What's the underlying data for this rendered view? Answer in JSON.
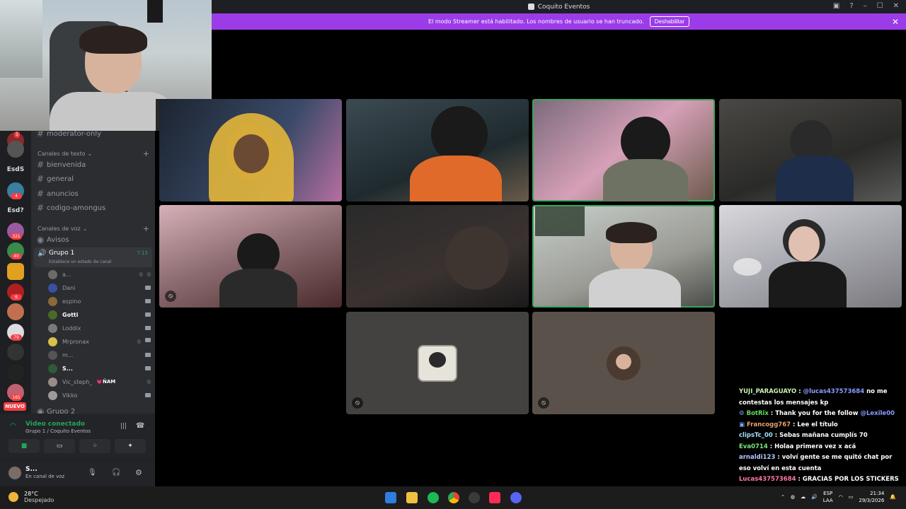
{
  "window": {
    "title": "Coquito Eventos"
  },
  "banner": {
    "text": "El modo Streamer está habilitado. Los nombres de usuario se han truncado.",
    "button": "Deshabilitar"
  },
  "server_rail": {
    "items": [
      {
        "label": "EsdS"
      },
      {
        "label": "Esd?"
      }
    ],
    "badges": [
      "4",
      "4",
      "321",
      "40",
      "6",
      "79",
      "165"
    ],
    "new_pill": "NUEVO"
  },
  "sidebar": {
    "top_channel": "moderator-only",
    "text_category": "Canales de texto",
    "text_channels": [
      "bienvenida",
      "general",
      "anuncios",
      "codigo-amongus"
    ],
    "voice_category": "Canales de voz",
    "voice_channels": [
      {
        "name": "Avisos"
      },
      {
        "name": "Grupo 1",
        "timer": "7:15",
        "status": "Establece un estado de canal"
      }
    ],
    "voice_users": [
      {
        "name": "a...",
        "color": "#6b6b6b"
      },
      {
        "name": "Dani",
        "color": "#3a4fa0"
      },
      {
        "name": "espino",
        "color": "#8a6a3a"
      },
      {
        "name": "Gotti",
        "color": "#4a6a2a"
      },
      {
        "name": "Loddix",
        "color": "#7a7a7a"
      },
      {
        "name": "Mrpronax",
        "color": "#d8c04a"
      },
      {
        "name": "m...",
        "color": "#555555"
      },
      {
        "name": "S...",
        "color": "#2e5a3a"
      },
      {
        "name": "Vic_steph_",
        "tag": "💗ÑAM",
        "color": "#9a8a8a"
      },
      {
        "name": "Vikko",
        "color": "#a09a9a"
      }
    ],
    "next_channel": "Grupo 2"
  },
  "voice_panel": {
    "status": "Video conectado",
    "location": "Grupo 1 / Coquito Eventos",
    "user_name": "S...",
    "user_status": "En canal de voz"
  },
  "stream_chat": [
    {
      "user": "YUJI_PARAGUAYO",
      "user_color": "#c8f0b0",
      "text": "",
      "mention": "@lucas437573684",
      "after": " no me contestas los mensajes kp"
    },
    {
      "user": "BotRix",
      "user_color": "#5ee05e",
      "text": "Thank you for the follow ",
      "mention": "@Lexile00",
      "after": ""
    },
    {
      "user": "Francogg767",
      "user_color": "#e8a26b",
      "text": "Lee el título",
      "mention": "",
      "after": ""
    },
    {
      "user": "clipsTc_00",
      "user_color": "#9fe0ff",
      "text": "Sebas mañana cumplís 70",
      "mention": "",
      "after": ""
    },
    {
      "user": "Eva0714",
      "user_color": "#7ae87a",
      "text": "Holaa primera vez x acá",
      "mention": "",
      "after": ""
    },
    {
      "user": "arnaldi123",
      "user_color": "#b6c7ff",
      "text": "volví gente se me quitó chat por eso volví en esta cuenta",
      "mention": "",
      "after": ""
    },
    {
      "user": "Lucas437573684",
      "user_color": "#ff7aa2",
      "text": "GRACIAS POR LOS STICKERS EN TIKTOK😭👾🔥",
      "mention": "",
      "after": ""
    }
  ],
  "taskbar": {
    "weather_temp": "28°C",
    "weather_desc": "Despejado",
    "lang_top": "ESP",
    "lang_bottom": "LAA",
    "time": "21:34",
    "date": "29/3/2026"
  },
  "colors": {
    "banner": "#9b3ce8",
    "speaking": "#3ba55d",
    "voice_connected": "#23a55a",
    "badge": "#f23f43"
  }
}
